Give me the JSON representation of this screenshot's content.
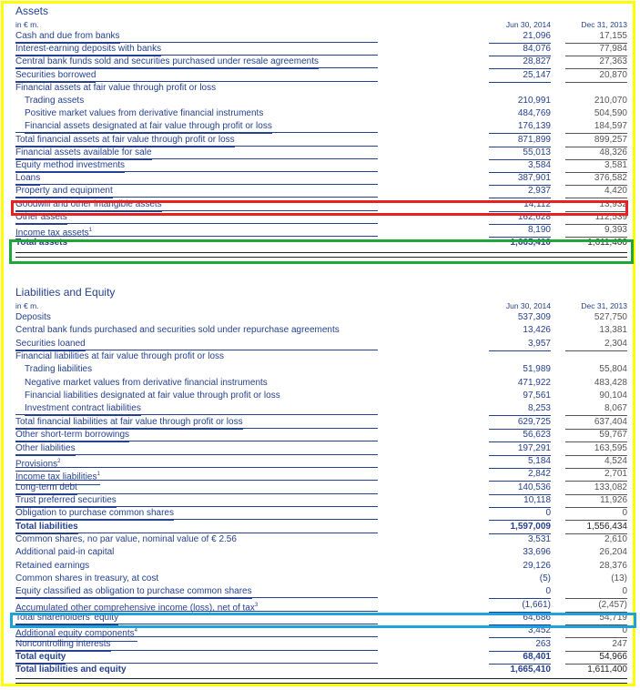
{
  "assets": {
    "title": "Assets",
    "unit": "in € m.",
    "col1": "Jun 30, 2014",
    "col2": "Dec 31, 2013",
    "rows": [
      {
        "label": "Cash and due from banks",
        "v1": "21,096",
        "v2": "17,155"
      },
      {
        "label": "Interest-earning deposits with banks",
        "v1": "84,076",
        "v2": "77,984"
      },
      {
        "label": "Central bank funds sold and securities purchased under resale agreements",
        "v1": "28,827",
        "v2": "27,363"
      },
      {
        "label": "Securities borrowed",
        "v1": "25,147",
        "v2": "20,870"
      },
      {
        "label": "Financial assets at fair value through profit or loss",
        "v1": "",
        "v2": ""
      },
      {
        "label": "Trading assets",
        "v1": "210,991",
        "v2": "210,070"
      },
      {
        "label": "Positive market values from derivative financial instruments",
        "v1": "484,769",
        "v2": "504,590"
      },
      {
        "label": "Financial assets designated at fair value through profit or loss",
        "v1": "176,139",
        "v2": "184,597"
      },
      {
        "label": "Total financial assets at fair value through profit or loss",
        "v1": "871,899",
        "v2": "899,257"
      },
      {
        "label": "Financial assets available for sale",
        "v1": "55,013",
        "v2": "48,326"
      },
      {
        "label": "Equity method investments",
        "v1": "3,584",
        "v2": "3,581"
      },
      {
        "label": "Loans",
        "v1": "387,901",
        "v2": "376,582"
      },
      {
        "label": "Property and equipment",
        "v1": "2,937",
        "v2": "4,420"
      },
      {
        "label": "Goodwill and other intangible assets",
        "v1": "14,112",
        "v2": "13,932"
      },
      {
        "label": "Other assets",
        "v1": "162,628",
        "v2": "112,539"
      },
      {
        "label": "Income tax assets",
        "sup": "1",
        "v1": "8,190",
        "v2": "9,393"
      },
      {
        "label": "Total assets",
        "v1": "1,665,410",
        "v2": "1,611,400"
      }
    ]
  },
  "liabilities": {
    "title": "Liabilities and Equity",
    "unit": "in € m.",
    "col1": "Jun 30, 2014",
    "col2": "Dec 31, 2013",
    "rows": [
      {
        "label": "Deposits",
        "v1": "537,309",
        "v2": "527,750"
      },
      {
        "label": "Central bank funds purchased and securities sold under repurchase agreements",
        "v1": "13,426",
        "v2": "13,381"
      },
      {
        "label": "Securities loaned",
        "v1": "3,957",
        "v2": "2,304"
      },
      {
        "label": "Financial liabilities at fair value through profit or loss",
        "v1": "",
        "v2": ""
      },
      {
        "label": "Trading liabilities",
        "v1": "51,989",
        "v2": "55,804"
      },
      {
        "label": "Negative market values from derivative financial instruments",
        "v1": "471,922",
        "v2": "483,428"
      },
      {
        "label": "Financial liabilities designated at fair value through profit or loss",
        "v1": "97,561",
        "v2": "90,104"
      },
      {
        "label": "Investment contract liabilities",
        "v1": "8,253",
        "v2": "8,067"
      },
      {
        "label": "Total financial liabilities at fair value through profit or loss",
        "v1": "629,725",
        "v2": "637,404"
      },
      {
        "label": "Other short-term borrowings",
        "v1": "56,623",
        "v2": "59,767"
      },
      {
        "label": "Other liabilities",
        "v1": "197,291",
        "v2": "163,595"
      },
      {
        "label": "Provisions",
        "sup": "2",
        "v1": "5,184",
        "v2": "4,524"
      },
      {
        "label": "Income tax liabilities",
        "sup": "1",
        "v1": "2,842",
        "v2": "2,701"
      },
      {
        "label": "Long-term debt",
        "v1": "140,536",
        "v2": "133,082"
      },
      {
        "label": "Trust preferred securities",
        "v1": "10,118",
        "v2": "11,926"
      },
      {
        "label": "Obligation to purchase common shares",
        "v1": "0",
        "v2": "0"
      },
      {
        "label": "Total liabilities",
        "v1": "1,597,009",
        "v2": "1,556,434"
      },
      {
        "label": "Common shares, no par value, nominal value of € 2.56",
        "v1": "3,531",
        "v2": "2,610"
      },
      {
        "label": "Additional paid-in capital",
        "v1": "33,696",
        "v2": "26,204"
      },
      {
        "label": "Retained earnings",
        "v1": "29,126",
        "v2": "28,376"
      },
      {
        "label": "Common shares in treasury, at cost",
        "v1": "(5)",
        "v2": "(13)"
      },
      {
        "label": "Equity classified as obligation to purchase common shares",
        "v1": "0",
        "v2": "0"
      },
      {
        "label": "Accumulated other comprehensive income (loss), net of tax",
        "sup": "3",
        "v1": "(1,661)",
        "v2": "(2,457)"
      },
      {
        "label": "Total shareholders' equity",
        "v1": "64,686",
        "v2": "54,719"
      },
      {
        "label": "Additional equity components",
        "sup": "4",
        "v1": "3,452",
        "v2": "0"
      },
      {
        "label": "Noncontrolling interests",
        "v1": "263",
        "v2": "247"
      },
      {
        "label": "Total equity",
        "v1": "68,401",
        "v2": "54,966"
      },
      {
        "label": "Total liabilities and equity",
        "v1": "1,665,410",
        "v2": "1,611,400"
      }
    ]
  },
  "highlight_colors": {
    "frame": "#ffff00",
    "red": "#e82020",
    "green": "#1fa637",
    "blue": "#1ca3dc"
  }
}
